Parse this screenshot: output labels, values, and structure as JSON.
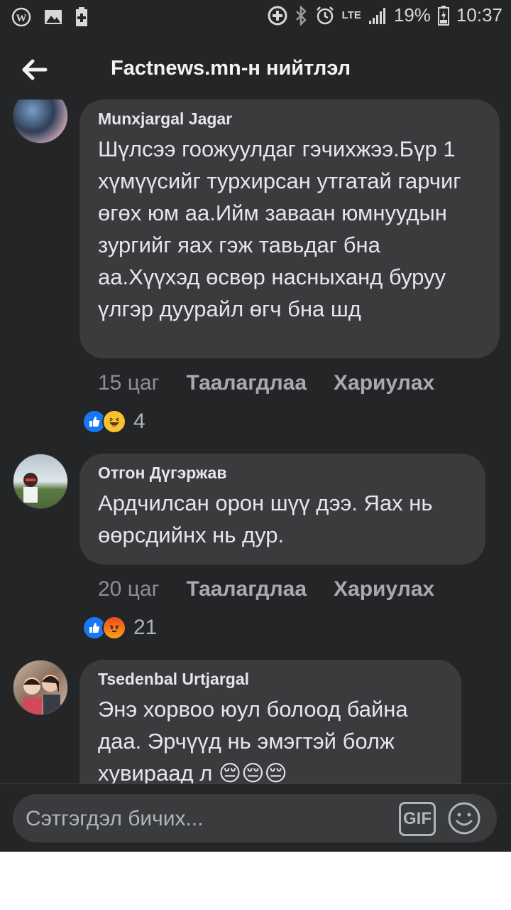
{
  "status_bar": {
    "battery": "19%",
    "time": "10:37",
    "network": "LTE",
    "icons": [
      "wordpress-icon",
      "gallery-icon",
      "battery-saver-icon",
      "data-saver-icon",
      "bluetooth-icon",
      "alarm-icon",
      "signal-icon",
      "battery-icon"
    ]
  },
  "header": {
    "title": "Factnews.mn-н нийтлэл",
    "back_icon": "arrow-left-icon"
  },
  "comments": [
    {
      "author": "Munxjargal Jagar",
      "text": "Шүлсээ гоожуулдаг гэчихжээ.Бүр 1 хүмүүсийг турхирсан утгатай гарчиг өгөх юм аа.Ийм заваан юмнуудын зургийг яах гэж тавьдаг бна аа.Хүүхэд өсвөр насныханд буруу үлгэр дуурайл өгч бна шд",
      "time": "15 цаг",
      "like_label": "Таалагдлаа",
      "reply_label": "Хариулах",
      "reactions": [
        "like",
        "haha"
      ],
      "reaction_count": "4"
    },
    {
      "author": "Отгон Дүгэржав",
      "text": "Ардчилсан орон шүү дээ. Яах нь өөрсдийнх нь дур.",
      "time": "20 цаг",
      "like_label": "Таалагдлаа",
      "reply_label": "Хариулах",
      "reactions": [
        "like",
        "angry"
      ],
      "reaction_count": "21"
    },
    {
      "author": "Tsedenbal Urtjargal",
      "text": "Энэ хорвоо юул болоод байна даа. Эрчүүд нь эмэгтэй болж хувираад л 😔😔😔",
      "time": "",
      "like_label": "",
      "reply_label": "",
      "reactions": [],
      "reaction_count": ""
    }
  ],
  "composer": {
    "placeholder": "Сэтгэгдэл бичих...",
    "gif_label": "GIF"
  },
  "colors": {
    "background": "#242526",
    "bubble": "#3a3b3c",
    "text": "#e4e6eb",
    "meta": "#8d8f93",
    "like_blue": "#1877f2",
    "haha_yellow": "#f7c22e",
    "angry_red": "#e9710f"
  }
}
